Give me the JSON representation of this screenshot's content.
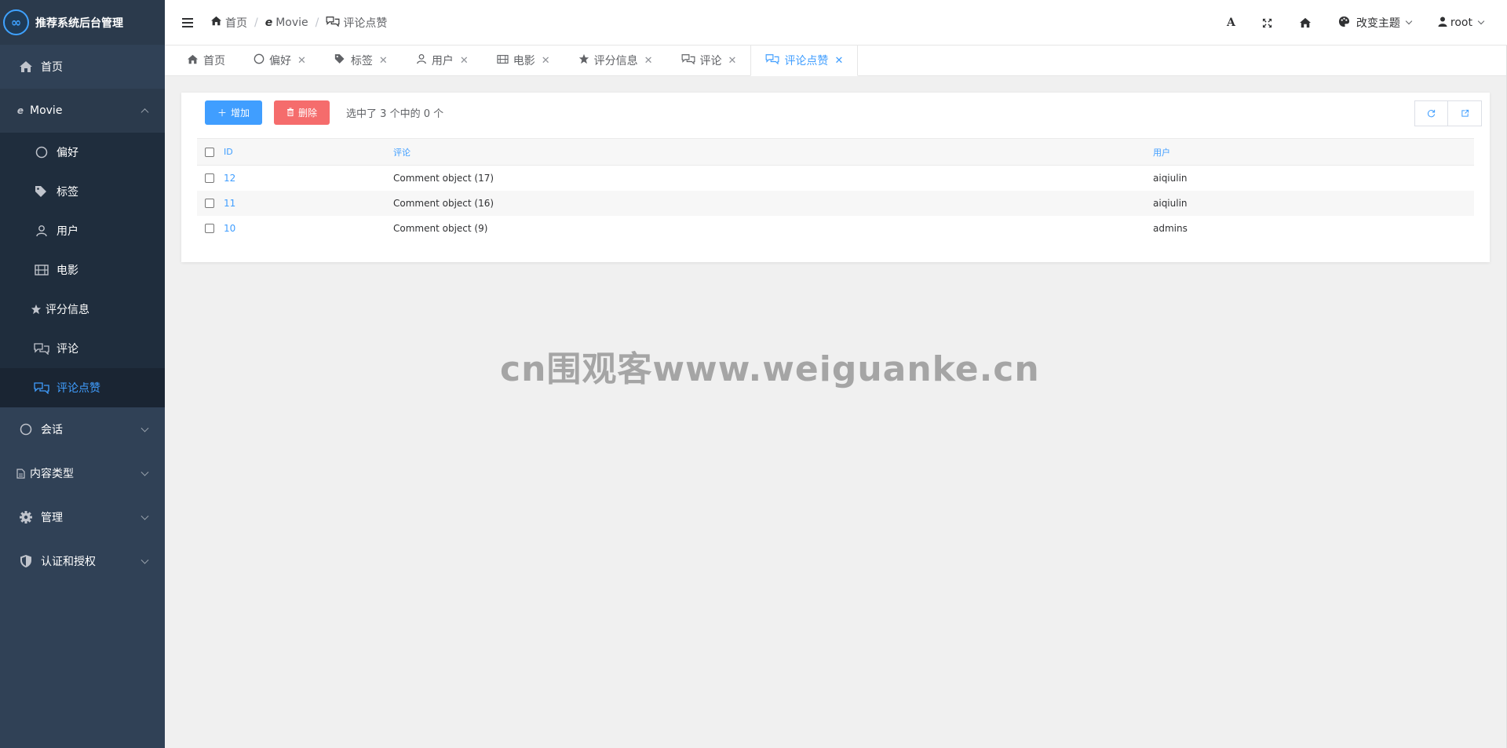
{
  "brand": {
    "logo": "∞",
    "title": "推荐系统后台管理"
  },
  "sidebar": {
    "home": "首页",
    "movie_group": "Movie",
    "movie_items": [
      {
        "label": "偏好",
        "icon": "circle-icon"
      },
      {
        "label": "标签",
        "icon": "tags-icon"
      },
      {
        "label": "用户",
        "icon": "user-icon"
      },
      {
        "label": "电影",
        "icon": "film-icon"
      },
      {
        "label": "评分信息",
        "icon": "star-icon"
      },
      {
        "label": "评论",
        "icon": "comments-icon"
      },
      {
        "label": "评论点赞",
        "icon": "comments-icon"
      }
    ],
    "groups": [
      {
        "label": "会话",
        "icon": "circle-icon"
      },
      {
        "label": "内容类型",
        "icon": "file-icon"
      },
      {
        "label": "管理",
        "icon": "gear-icon"
      },
      {
        "label": "认证和授权",
        "icon": "shield-icon"
      }
    ]
  },
  "header": {
    "breadcrumb": [
      "首页",
      "Movie",
      "评论点赞"
    ],
    "theme_label": "改变主题",
    "user_label": "root"
  },
  "tabs": [
    "首页",
    "偏好",
    "标签",
    "用户",
    "电影",
    "评分信息",
    "评论",
    "评论点赞"
  ],
  "toolbar": {
    "add_label": "增加",
    "delete_label": "删除",
    "selection_text": "选中了 3 个中的 0 个"
  },
  "table": {
    "headers": {
      "id": "ID",
      "comment": "评论",
      "user": "用户"
    },
    "rows": [
      {
        "id": "12",
        "comment": "Comment object (17)",
        "user": "aiqiulin"
      },
      {
        "id": "11",
        "comment": "Comment object (16)",
        "user": "aiqiulin"
      },
      {
        "id": "10",
        "comment": "Comment object (9)",
        "user": "admins"
      }
    ]
  },
  "watermark": "cn围观客www.weiguanke.cn",
  "colors": {
    "accent": "#409eff",
    "danger": "#f56c6c",
    "sidebar": "#304156"
  }
}
